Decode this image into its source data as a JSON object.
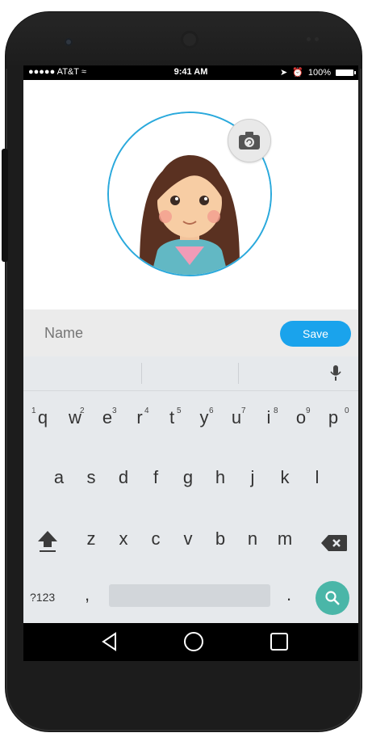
{
  "status_bar": {
    "carrier": "●●●●● AT&T",
    "time": "9:41 AM",
    "battery": "100%"
  },
  "profile": {
    "avatar_alt": "",
    "camera_icon": "camera-icon"
  },
  "form": {
    "name_placeholder": "Name",
    "save_label": "Save"
  },
  "keyboard": {
    "row1": [
      {
        "key": "q",
        "num": "1"
      },
      {
        "key": "w",
        "num": "2"
      },
      {
        "key": "e",
        "num": "3"
      },
      {
        "key": "r",
        "num": "4"
      },
      {
        "key": "t",
        "num": "5"
      },
      {
        "key": "y",
        "num": "6"
      },
      {
        "key": "u",
        "num": "7"
      },
      {
        "key": "i",
        "num": "8"
      },
      {
        "key": "o",
        "num": "9"
      },
      {
        "key": "p",
        "num": "0"
      }
    ],
    "row2": [
      "a",
      "s",
      "d",
      "f",
      "g",
      "h",
      "j",
      "k",
      "l"
    ],
    "row3": [
      "z",
      "x",
      "c",
      "v",
      "b",
      "n",
      "m"
    ],
    "symbols_label": "?123",
    "comma": ",",
    "period": "."
  },
  "colors": {
    "accent": "#1aa3ec",
    "avatar_ring": "#2aa9dc",
    "search_key": "#4ab6a8"
  }
}
